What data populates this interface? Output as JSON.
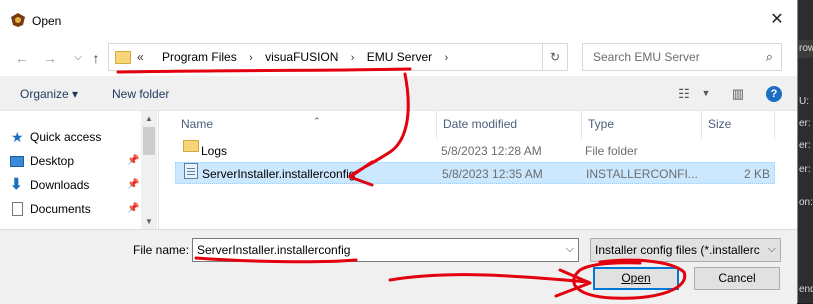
{
  "window": {
    "title": "Open",
    "close_glyph": "✕"
  },
  "nav": {
    "back_glyph": "←",
    "forward_glyph": "→",
    "up_glyph": "↑"
  },
  "address": {
    "prefix": "«",
    "crumbs": [
      "Program Files",
      "visuaFUSION",
      "EMU Server"
    ],
    "sep": "›",
    "dropdown_glyph": "⌵",
    "refresh_glyph": "↻"
  },
  "search": {
    "placeholder": "Search EMU Server"
  },
  "toolbar": {
    "organize": "Organize ▾",
    "new_folder": "New folder"
  },
  "sidebar": {
    "items": [
      {
        "label": "Quick access",
        "icon": "star-icon",
        "pinned": false
      },
      {
        "label": "Desktop",
        "icon": "desktop-icon",
        "pinned": true
      },
      {
        "label": "Downloads",
        "icon": "download-icon",
        "pinned": true
      },
      {
        "label": "Documents",
        "icon": "document-icon",
        "pinned": true
      }
    ]
  },
  "columns": {
    "name": "Name",
    "date": "Date modified",
    "type": "Type",
    "size": "Size"
  },
  "files": [
    {
      "name": "Logs",
      "date": "5/8/2023 12:28 AM",
      "type": "File folder",
      "size": "",
      "kind": "folder",
      "selected": false
    },
    {
      "name": "ServerInstaller.installerconfig",
      "date": "5/8/2023 12:35 AM",
      "type": "INSTALLERCONFI...",
      "size": "2 KB",
      "kind": "file",
      "selected": true
    }
  ],
  "footer": {
    "filename_label": "File name:",
    "filename_value": "ServerInstaller.installerconfig",
    "filetype_value": "Installer config files (*.installerc",
    "open_label": "Open",
    "cancel_label": "Cancel"
  },
  "behind_window": {
    "lines": [
      "row",
      "U:",
      "er:",
      "er:",
      "er:",
      "on:",
      "end"
    ]
  },
  "colors": {
    "accent": "#0078d7",
    "selection": "#cce8ff",
    "annotation": "#e3000f"
  }
}
